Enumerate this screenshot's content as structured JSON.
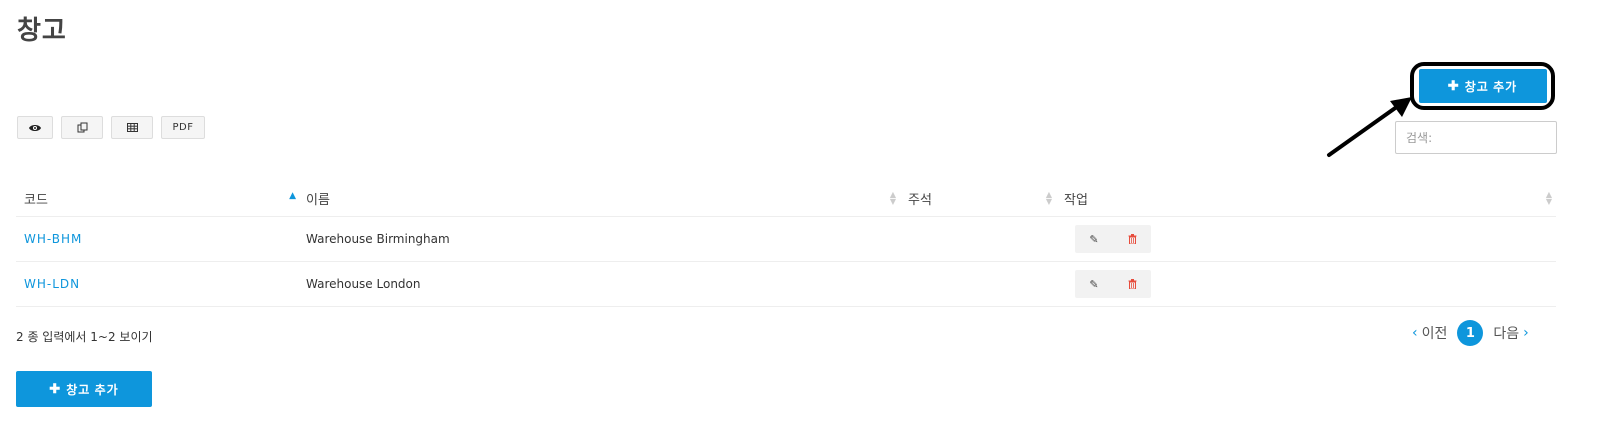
{
  "page": {
    "title": "창고"
  },
  "toolbar": {
    "export_buttons": [
      {
        "icon": "eye-icon",
        "label": "👁"
      },
      {
        "icon": "copy-icon",
        "label": "⧉"
      },
      {
        "icon": "table-icon",
        "label": "▦"
      },
      {
        "icon": "pdf-icon",
        "label": "PDF"
      }
    ],
    "add_button_label": "창고 추가",
    "add_button_icon": "✚"
  },
  "search": {
    "placeholder": "검색:"
  },
  "table": {
    "columns": [
      "코드",
      "이름",
      "주석",
      "작업"
    ],
    "rows": [
      {
        "code": "WH-BHM",
        "name": "Warehouse Birmingham",
        "note": ""
      },
      {
        "code": "WH-LDN",
        "name": "Warehouse London",
        "note": ""
      }
    ],
    "actions": {
      "edit_icon": "✎",
      "delete_icon": "🗑"
    }
  },
  "footer": {
    "info": "2 종 입력에서 1~2 보이기",
    "prev_label": "이전",
    "next_label": "다음",
    "current_page": "1",
    "prev_chevron": "‹",
    "next_chevron": "›"
  },
  "colors": {
    "accent": "#0e96dc",
    "delete": "#e74c3c"
  }
}
